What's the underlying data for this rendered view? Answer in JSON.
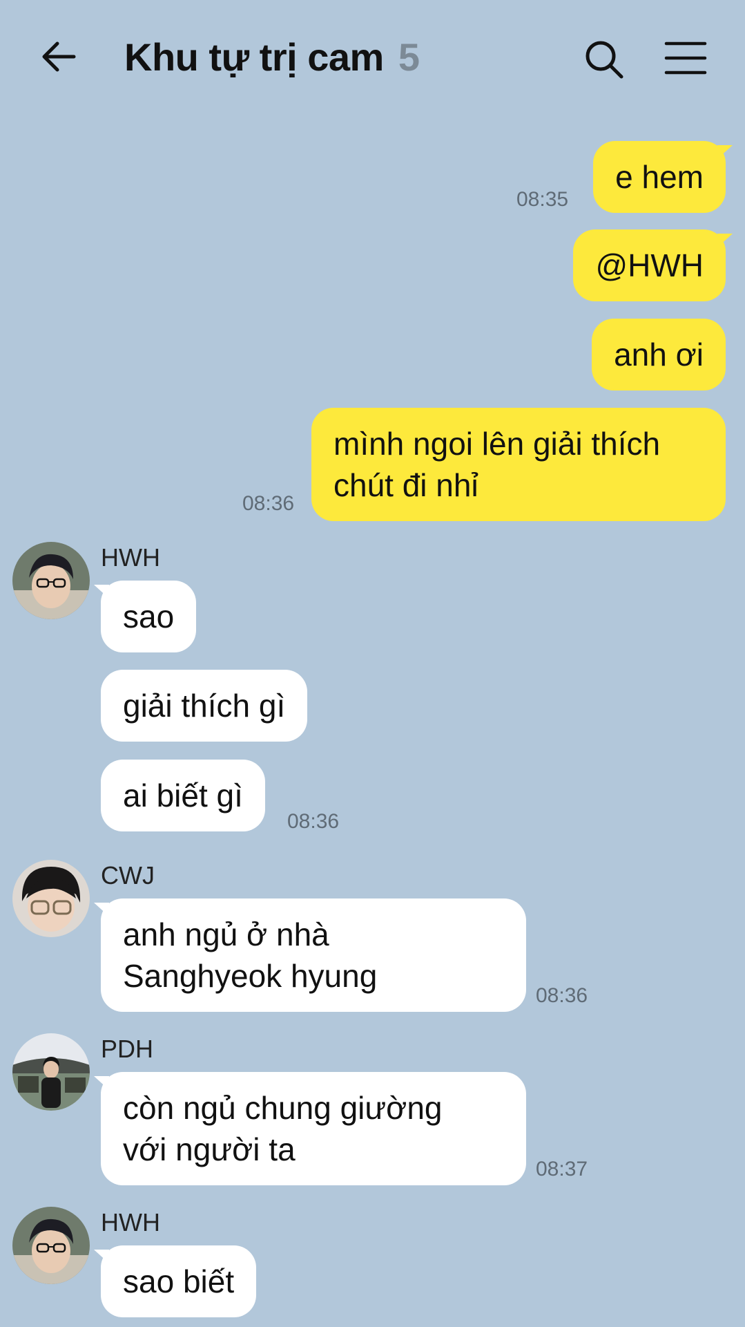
{
  "header": {
    "title": "Khu tự trị cam",
    "member_count": "5",
    "back_icon": "arrow-left-icon",
    "search_icon": "search-icon",
    "menu_icon": "menu-icon"
  },
  "colors": {
    "background": "#b2c7da",
    "my_bubble": "#fde93c",
    "their_bubble": "#ffffff"
  },
  "messages": [
    {
      "from": "me",
      "text": "e hem",
      "time": "08:35"
    },
    {
      "from": "me",
      "text": "@HWH"
    },
    {
      "from": "me",
      "text": "anh ơi"
    },
    {
      "from": "me",
      "line1": "mình ngoi lên giải thích",
      "line2": "chút đi nhỉ",
      "time": "08:36"
    },
    {
      "from": "HWH",
      "text": "sao"
    },
    {
      "from": "HWH",
      "text": "giải thích gì"
    },
    {
      "from": "HWH",
      "text": "ai biết gì",
      "time": "08:36"
    },
    {
      "from": "CWJ",
      "line1": "anh ngủ ở nhà",
      "line2": "Sanghyeok hyung",
      "time": "08:36"
    },
    {
      "from": "PDH",
      "line1": "còn ngủ chung giường",
      "line2": "với người ta",
      "time": "08:37"
    },
    {
      "from": "HWH",
      "text": "sao biết"
    }
  ]
}
